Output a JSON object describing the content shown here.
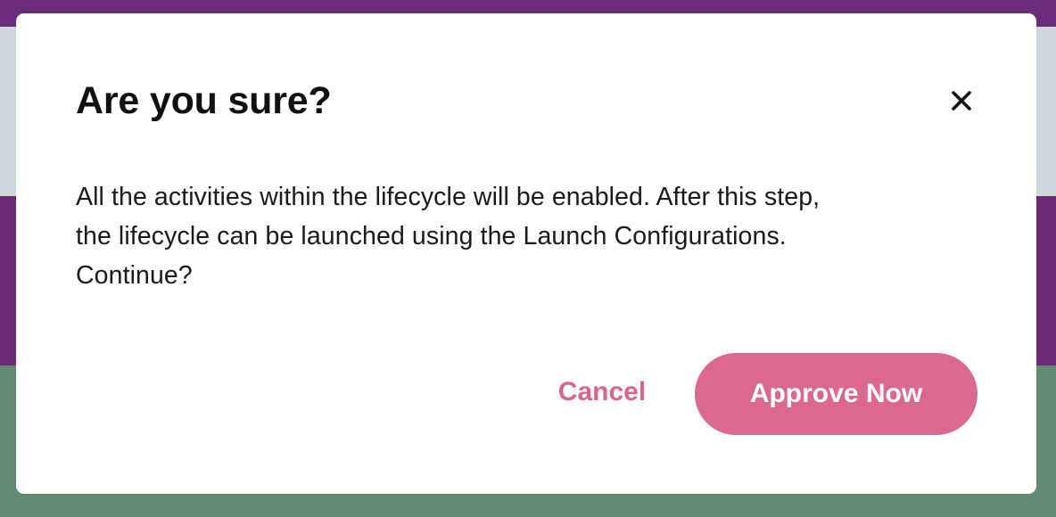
{
  "dialog": {
    "title": "Are you sure?",
    "close_icon": "close-icon",
    "body_lines": [
      "All the activities within the lifecycle will be enabled. After this step,",
      "the lifecycle can be launched using the Launch Configurations.",
      "Continue?"
    ],
    "cancel_label": "Cancel",
    "approve_label": "Approve Now"
  },
  "colors": {
    "accent": "#da6891",
    "cancel_text": "#d9648c",
    "modal_background": "#ffffff",
    "backdrop_purple": "#6b2a72",
    "backdrop_green": "#5f8c73"
  }
}
